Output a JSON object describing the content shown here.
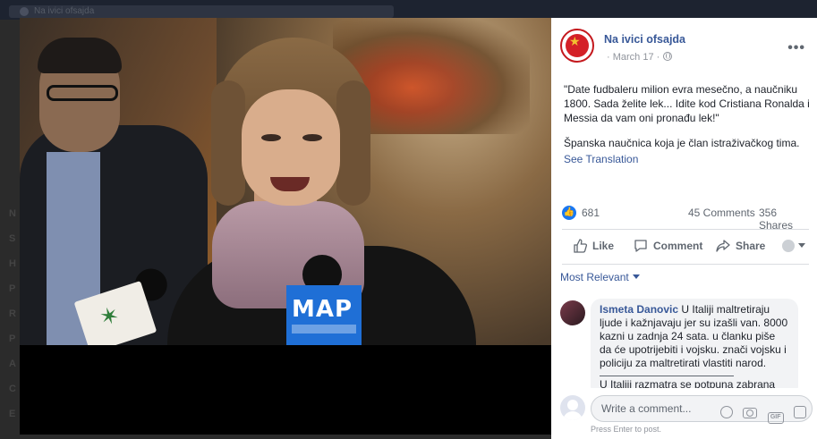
{
  "background": {
    "tab_title": "Na ivici ofsajda",
    "side_letters": [
      "N",
      "S",
      "H",
      "P",
      "R",
      "P",
      "A",
      "C",
      "E"
    ]
  },
  "photo": {
    "mic_label": "MAP"
  },
  "post": {
    "page_name": "Na ivici ofsajda",
    "date": "March 17",
    "privacy_icon": "globe-icon",
    "more_icon": "more-icon",
    "paragraph_1": "\"Date fudbaleru milion evra mesečno, a naučniku 1800. Sada želite lek... Idite kod Cristiana Ronalda i Messia da vam oni pronađu lek!\"",
    "paragraph_2": "Španska naučnica koja je član istraživačkog tima.",
    "see_translation": "See Translation",
    "like_count": "681",
    "comments_count": "45 Comments",
    "shares_count": "356 Shares"
  },
  "actions": {
    "like": "Like",
    "comment": "Comment",
    "share": "Share"
  },
  "comments": {
    "sort_label": "Most Relevant",
    "items": [
      {
        "author": "Ismeta Danovic",
        "text": "U Italiji maltretiraju ljude i kažnjavaju jer su izašli van. 8000 kazni u zadnja 24 sata. u članku piše da će upotrijebiti i vojsku. znači vojsku i policiju za maltretirati vlastiti narod.",
        "text_2": "U Italiji razmatra se potpuna zabrana"
      }
    ]
  },
  "reply": {
    "placeholder": "Write a comment...",
    "hint": "Press Enter to post."
  },
  "colors": {
    "link_blue": "#385898",
    "like_blue": "#1877f2",
    "mic_blue": "#1f6fd6",
    "avatar_red": "#d42027"
  }
}
